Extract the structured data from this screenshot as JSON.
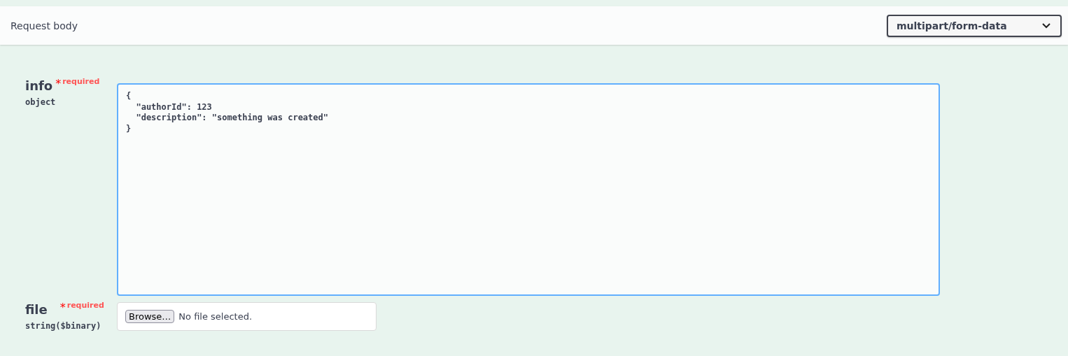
{
  "request_body": {
    "title": "Request body",
    "content_type": "multipart/form-data"
  },
  "parameters": [
    {
      "kind": "textarea",
      "name": "info",
      "required_mark": "*",
      "required_label": "required",
      "type": "object",
      "focused": true,
      "value": "{\n  \"authorId\": 123\n  \"description\": \"something was created\"\n}"
    },
    {
      "kind": "file",
      "name": "file",
      "required_mark": "*",
      "required_label": "required",
      "type": "string($binary)",
      "button": "Browse…",
      "status": "No file selected."
    }
  ]
}
